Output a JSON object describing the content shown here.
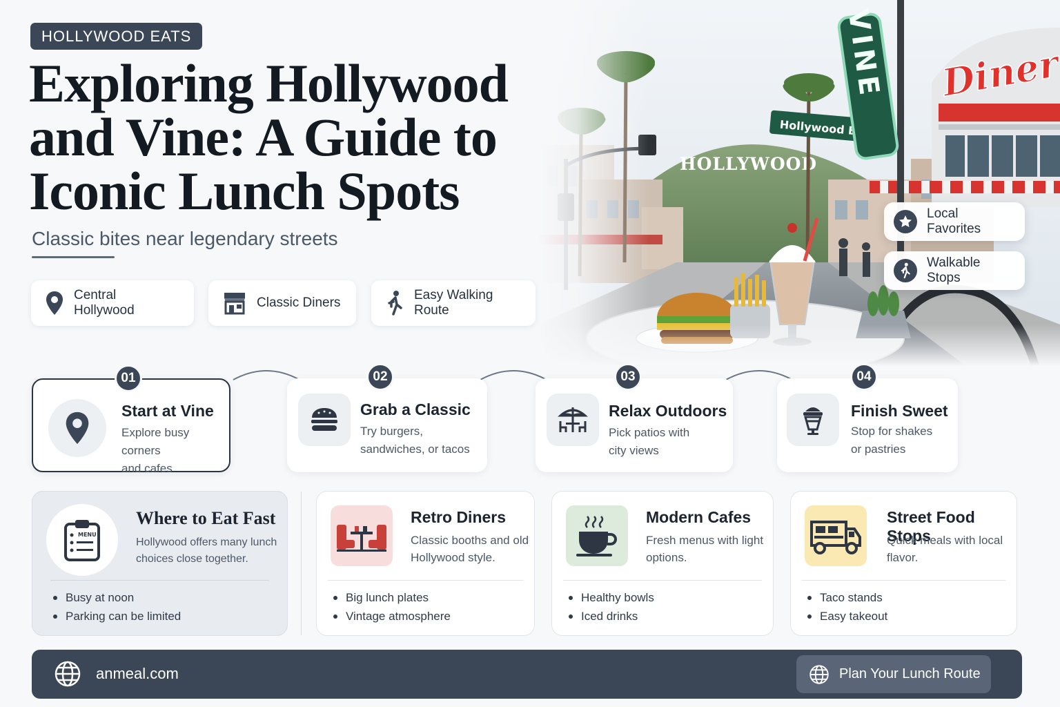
{
  "header": {
    "tag": "HOLLYWOOD EATS",
    "title": "Exploring Hollywood and Vine: A Guide to Iconic Lunch Spots",
    "subtitle": "Classic bites near legendary streets"
  },
  "chips": [
    {
      "label": "Central Hollywood",
      "icon": "map-pin-icon"
    },
    {
      "label": "Classic Diners",
      "icon": "storefront-icon"
    },
    {
      "label": "Easy Walking Route",
      "icon": "walking-person-icon"
    }
  ],
  "hero": {
    "signs": {
      "vine": "VINE",
      "street": "Hollywood Bl",
      "hillside": "HOLLYWOOD",
      "diner": "Diner"
    },
    "badges": [
      {
        "label": "Local Favorites",
        "icon": "star-icon"
      },
      {
        "label": "Walkable Stops",
        "icon": "walking-person-icon"
      }
    ]
  },
  "steps": [
    {
      "num": "01",
      "title": "Start at Vine",
      "desc_1": "Explore busy corners",
      "desc_2": "and cafes",
      "icon": "map-pin-icon"
    },
    {
      "num": "02",
      "title": "Grab a Classic",
      "desc_1": "Try burgers,",
      "desc_2": "sandwiches, or tacos",
      "icon": "burger-icon"
    },
    {
      "num": "03",
      "title": "Relax Outdoors",
      "desc_1": "Pick patios with",
      "desc_2": "city views",
      "icon": "patio-umbrella-icon"
    },
    {
      "num": "04",
      "title": "Finish Sweet",
      "desc_1": "Stop for shakes",
      "desc_2": "or pastries",
      "icon": "milkshake-icon"
    }
  ],
  "intro_card": {
    "title": "Where to Eat Fast",
    "desc": "Hollywood offers many lunch choices close together.",
    "menu_label": "MENU",
    "bullets": [
      "Busy at noon",
      "Parking can be limited"
    ]
  },
  "cards": [
    {
      "title": "Retro Diners",
      "desc": "Classic booths and old Hollywood style.",
      "bullets": [
        "Big lunch plates",
        "Vintage atmosphere"
      ],
      "icon": "diner-booth-icon",
      "tint": "#f7dedd"
    },
    {
      "title": "Modern Cafes",
      "desc": "Fresh menus with light options.",
      "bullets": [
        "Healthy bowls",
        "Iced drinks"
      ],
      "icon": "coffee-cup-icon",
      "tint": "#dcebdc"
    },
    {
      "title": "Street Food Stops",
      "desc": "Quick meals with local flavor.",
      "bullets": [
        "Taco stands",
        "Easy takeout"
      ],
      "icon": "food-truck-icon",
      "tint": "#fbe9b3"
    }
  ],
  "footer": {
    "site": "anmeal.com",
    "button": "Plan Your Lunch Route"
  },
  "colors": {
    "primary": "#3b4656",
    "background": "#f7f8fa",
    "diner_red": "#d8342f"
  }
}
